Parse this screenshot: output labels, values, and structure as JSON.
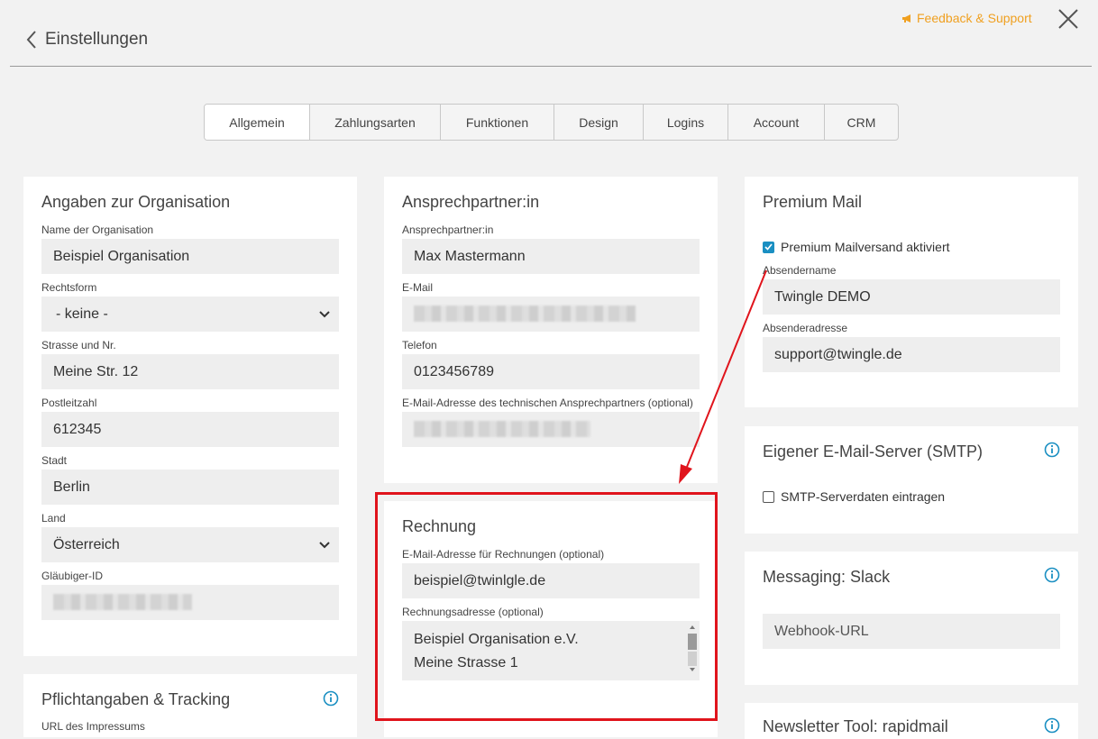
{
  "header": {
    "back_label": "Einstellungen",
    "feedback_label": "Feedback & Support"
  },
  "tabs": [
    {
      "label": "Allgemein",
      "active": true
    },
    {
      "label": "Zahlungsarten"
    },
    {
      "label": "Funktionen"
    },
    {
      "label": "Design"
    },
    {
      "label": "Logins"
    },
    {
      "label": "Account"
    },
    {
      "label": "CRM"
    }
  ],
  "organisation": {
    "title": "Angaben zur Organisation",
    "name_label": "Name der Organisation",
    "name_value": "Beispiel Organisation",
    "rechtsform_label": "Rechtsform",
    "rechtsform_value": "- keine -",
    "strasse_label": "Strasse und Nr.",
    "strasse_value": "Meine Str. 12",
    "plz_label": "Postleitzahl",
    "plz_value": "612345",
    "stadt_label": "Stadt",
    "stadt_value": "Berlin",
    "land_label": "Land",
    "land_value": "Österreich",
    "glaeubiger_label": "Gläubiger-ID"
  },
  "pflicht": {
    "title": "Pflichtangaben & Tracking",
    "impressum_label": "URL des Impressums"
  },
  "ansprech": {
    "title": "Ansprechpartner:in",
    "name_label": "Ansprechpartner:in",
    "name_value": "Max Mastermann",
    "email_label": "E-Mail",
    "telefon_label": "Telefon",
    "telefon_value": "0123456789",
    "tech_email_label": "E-Mail-Adresse des technischen Ansprechpartners (optional)"
  },
  "rechnung": {
    "title": "Rechnung",
    "email_label": "E-Mail-Adresse für Rechnungen (optional)",
    "email_value": "beispiel@twinlgle.de",
    "adresse_label": "Rechnungsadresse (optional)",
    "adresse_line1": "Beispiel Organisation e.V.",
    "adresse_line2": "Meine Strasse 1"
  },
  "premium": {
    "title": "Premium Mail",
    "checkbox_label": "Premium Mailversand aktiviert",
    "checked": true,
    "absender_name_label": "Absendername",
    "absender_name_value": "Twingle DEMO",
    "absender_adresse_label": "Absenderadresse",
    "absender_adresse_value": "support@twingle.de"
  },
  "smtp": {
    "title": "Eigener E-Mail-Server (SMTP)",
    "checkbox_label": "SMTP-Serverdaten eintragen",
    "checked": false
  },
  "slack": {
    "title": "Messaging: Slack",
    "webhook_placeholder": "Webhook-URL"
  },
  "newsletter": {
    "title": "Newsletter Tool: rapidmail"
  },
  "colors": {
    "accent": "#1a8fc2",
    "feedback": "#f0a020",
    "highlight": "#e0141c"
  }
}
